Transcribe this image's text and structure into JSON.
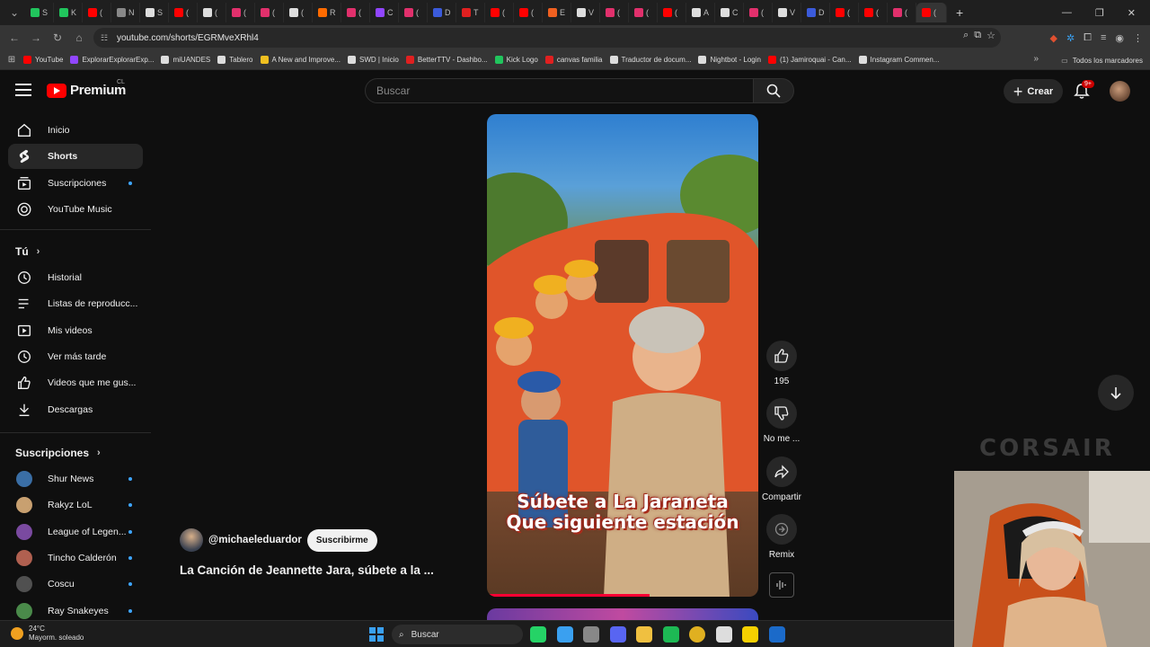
{
  "browser": {
    "tabs": [
      {
        "label": "S",
        "color": "#21c55d"
      },
      {
        "label": "K",
        "color": "#21c55d"
      },
      {
        "label": "(",
        "color": "#ff0000"
      },
      {
        "label": "N",
        "color": "#888888"
      },
      {
        "label": "S",
        "color": "#dddddd"
      },
      {
        "label": "(",
        "color": "#ff0000"
      },
      {
        "label": "(",
        "color": "#dddddd"
      },
      {
        "label": "(",
        "color": "#e1306c"
      },
      {
        "label": "(",
        "color": "#e1306c"
      },
      {
        "label": "(",
        "color": "#dddddd"
      },
      {
        "label": "R",
        "color": "#ff6b00"
      },
      {
        "label": "(",
        "color": "#e1306c"
      },
      {
        "label": "C",
        "color": "#9146ff"
      },
      {
        "label": "(",
        "color": "#e1306c"
      },
      {
        "label": "D",
        "color": "#3b5bdb"
      },
      {
        "label": "T",
        "color": "#e02020"
      },
      {
        "label": "(",
        "color": "#ff0000"
      },
      {
        "label": "(",
        "color": "#ff0000"
      },
      {
        "label": "E",
        "color": "#f06020"
      },
      {
        "label": "V",
        "color": "#dddddd"
      },
      {
        "label": "(",
        "color": "#e1306c"
      },
      {
        "label": "(",
        "color": "#e1306c"
      },
      {
        "label": "(",
        "color": "#ff0000"
      },
      {
        "label": "A",
        "color": "#dddddd"
      },
      {
        "label": "C",
        "color": "#dddddd"
      },
      {
        "label": "(",
        "color": "#e1306c"
      },
      {
        "label": "V",
        "color": "#dddddd"
      },
      {
        "label": "D",
        "color": "#3b5bdb"
      },
      {
        "label": "(",
        "color": "#ff0000"
      },
      {
        "label": "(",
        "color": "#ff0000"
      },
      {
        "label": "(",
        "color": "#e1306c"
      },
      {
        "label": "(",
        "color": "#ff0000"
      }
    ],
    "url": "youtube.com/shorts/EGRMveXRhl4",
    "bookmarks": [
      {
        "label": "YouTube",
        "color": "#ff0000"
      },
      {
        "label": "ExplorarExplorarExp...",
        "color": "#9146ff"
      },
      {
        "label": "miUANDES",
        "color": "#dddddd"
      },
      {
        "label": "Tablero",
        "color": "#dddddd"
      },
      {
        "label": "A New and Improve...",
        "color": "#f0c020"
      },
      {
        "label": "SWD | Inicio",
        "color": "#dddddd"
      },
      {
        "label": "BetterTTV - Dashbo...",
        "color": "#e02020"
      },
      {
        "label": "Kick Logo",
        "color": "#21c55d"
      },
      {
        "label": "canvas familia",
        "color": "#e02020"
      },
      {
        "label": "Traductor de docum...",
        "color": "#dddddd"
      },
      {
        "label": "Nightbot - Login",
        "color": "#dddddd"
      },
      {
        "label": "(1) Jamiroquai - Can...",
        "color": "#ff0000"
      },
      {
        "label": "Instagram Commen...",
        "color": "#dddddd"
      }
    ],
    "all_bookmarks": "Todos los marcadores"
  },
  "header": {
    "logo": "Premium",
    "country": "CL",
    "search_placeholder": "Buscar",
    "create_label": "Crear",
    "notif_count": "9+"
  },
  "sidebar": {
    "main": [
      {
        "label": "Inicio",
        "icon": "home-icon"
      },
      {
        "label": "Shorts",
        "icon": "shorts-icon",
        "active": true
      },
      {
        "label": "Suscripciones",
        "icon": "subscriptions-icon",
        "dot": true
      },
      {
        "label": "YouTube Music",
        "icon": "music-icon"
      }
    ],
    "you_title": "Tú",
    "you": [
      {
        "label": "Historial",
        "icon": "history-icon"
      },
      {
        "label": "Listas de reproducc...",
        "icon": "playlists-icon"
      },
      {
        "label": "Mis videos",
        "icon": "my-videos-icon"
      },
      {
        "label": "Ver más tarde",
        "icon": "watch-later-icon"
      },
      {
        "label": "Videos que me gus...",
        "icon": "liked-icon"
      },
      {
        "label": "Descargas",
        "icon": "downloads-icon"
      }
    ],
    "subs_title": "Suscripciones",
    "subs": [
      {
        "label": "Shur News",
        "color": "#3a6ea5"
      },
      {
        "label": "Rakyz LoL",
        "color": "#c8a070"
      },
      {
        "label": "League of Legen...",
        "color": "#7a4aa0"
      },
      {
        "label": "Tincho Calderón",
        "color": "#b06050"
      },
      {
        "label": "Coscu",
        "color": "#505050"
      },
      {
        "label": "Ray Snakeyes",
        "color": "#4a8a4a"
      }
    ]
  },
  "short": {
    "caption_line1": "Súbete a La Jaraneta",
    "caption_line2": "Que siguiente estación",
    "channel": "@michaeleduardor",
    "subscribe_label": "Suscribirme",
    "title": "La Canción de Jeannette Jara, súbete a la ...",
    "progress": 0.6,
    "actions": {
      "like_count": "195",
      "dislike_label": "No me ...",
      "share_label": "Compartir",
      "remix_label": "Remix"
    }
  },
  "overlay": {
    "brand": "CORSAIR"
  },
  "taskbar": {
    "temp": "24°C",
    "weather": "Mayorm. soleado",
    "search": "Buscar",
    "apps": [
      {
        "name": "whatsapp-icon",
        "color": "#25d366"
      },
      {
        "name": "notepad-icon",
        "color": "#3aa0f0"
      },
      {
        "name": "xbox-icon",
        "color": "#888888"
      },
      {
        "name": "discord-icon",
        "color": "#5865f2"
      },
      {
        "name": "folder-icon",
        "color": "#f0c040"
      },
      {
        "name": "spotify-icon",
        "color": "#1db954"
      },
      {
        "name": "chrome-icon",
        "color": "#e0b020"
      },
      {
        "name": "obs-icon",
        "color": "#dddddd"
      },
      {
        "name": "sticky-notes-icon",
        "color": "#f5d000"
      },
      {
        "name": "steam-icon",
        "color": "#1b6ac9"
      }
    ]
  }
}
